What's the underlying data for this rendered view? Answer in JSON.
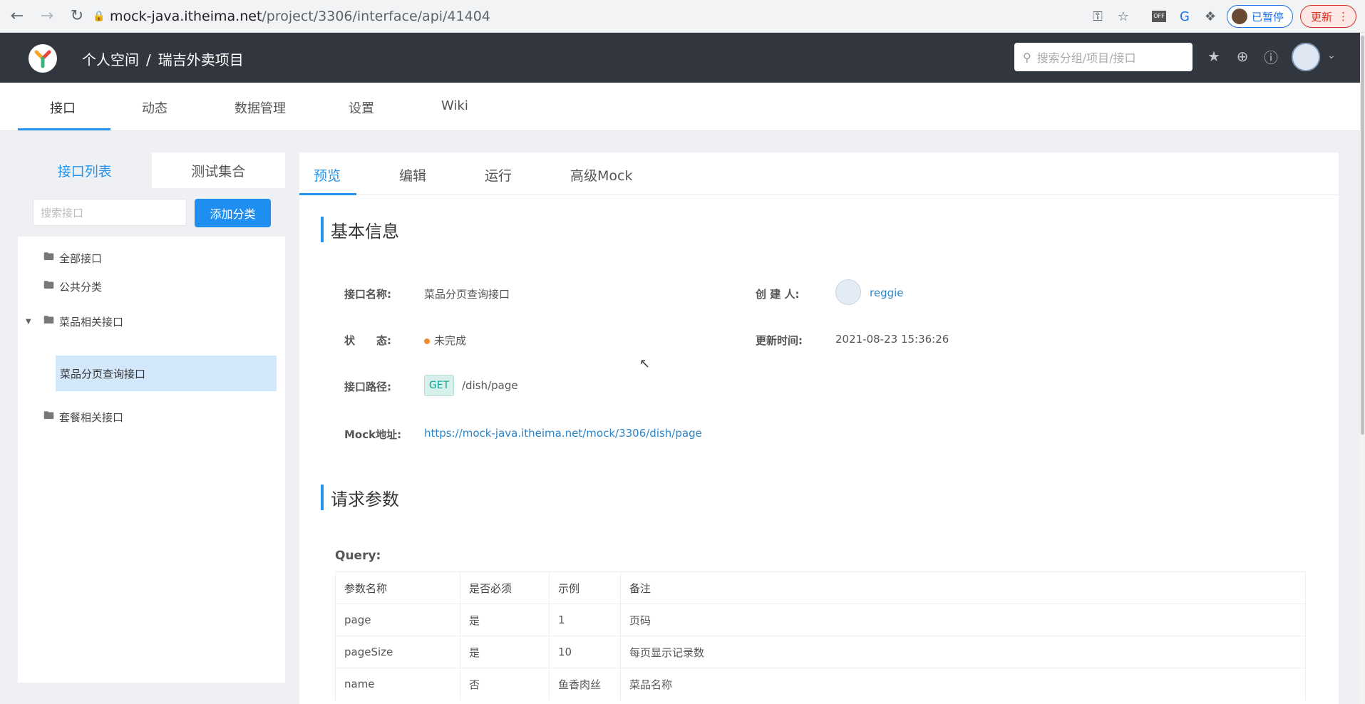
{
  "browser": {
    "url_host": "mock-java.itheima.net",
    "url_path": "/project/3306/interface/api/41404",
    "paused_label": "已暂停",
    "update_label": "更新",
    "icons": [
      "back-icon",
      "forward-icon",
      "reload-icon",
      "lock-icon",
      "key-icon",
      "star-icon",
      "off-extension-icon",
      "translate-icon",
      "puzzle-icon",
      "menu-kebab-icon"
    ]
  },
  "header": {
    "breadcrumb_1": "个人空间",
    "breadcrumb_sep": "/",
    "breadcrumb_2": "瑞吉外卖项目",
    "search_placeholder": "搜索分组/项目/接口"
  },
  "subnav": {
    "tabs": [
      "接口",
      "动态",
      "数据管理",
      "设置",
      "Wiki"
    ]
  },
  "sidebar": {
    "tab_active": "接口列表",
    "tab_other": "测试集合",
    "search_placeholder": "搜索接口",
    "add_button": "添加分类",
    "items": [
      {
        "label": "全部接口"
      },
      {
        "label": "公共分类"
      },
      {
        "label": "菜品相关接口"
      },
      {
        "label": "菜品分页查询接口"
      },
      {
        "label": "套餐相关接口"
      }
    ]
  },
  "main": {
    "tabs": [
      "预览",
      "编辑",
      "运行",
      "高级Mock"
    ],
    "basic_title": "基本信息",
    "name_label": "接口名称:",
    "name_value": "菜品分页查询接口",
    "creator_label": "创 建 人:",
    "creator_value": "reggie",
    "status_label": "状　　态:",
    "status_value": "未完成",
    "status_color": "#f08c2e",
    "updated_label": "更新时间:",
    "updated_value": "2021-08-23 15:36:26",
    "path_label": "接口路径:",
    "method": "GET",
    "path_value": "/dish/page",
    "mock_label": "Mock地址:",
    "mock_value": "https://mock-java.itheima.net/mock/3306/dish/page",
    "request_title": "请求参数",
    "query_label": "Query:",
    "table": {
      "headers": [
        "参数名称",
        "是否必须",
        "示例",
        "备注"
      ],
      "rows": [
        [
          "page",
          "是",
          "1",
          "页码"
        ],
        [
          "pageSize",
          "是",
          "10",
          "每页显示记录数"
        ],
        [
          "name",
          "否",
          "鱼香肉丝",
          "菜品名称"
        ]
      ]
    }
  }
}
